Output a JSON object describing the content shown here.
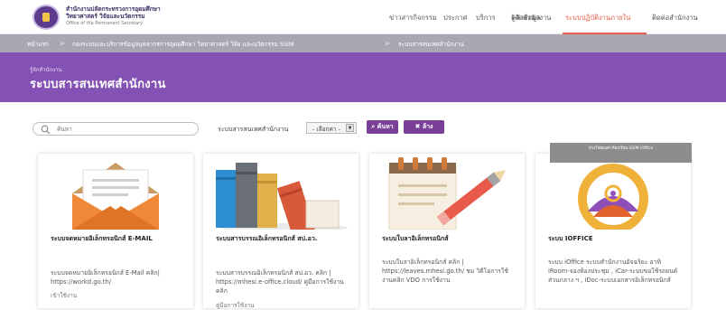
{
  "header": {
    "org_line1": "สำนักงานปลัดกระทรวงการอุดมศึกษา",
    "org_line2": "วิทยาศาสตร์ วิจัยและนวัตกรรม",
    "org_line3": "Office of the Permanent Secretary",
    "nav": [
      {
        "label": "ข่าวสารกิจกรรม"
      },
      {
        "label": "ประกาศ"
      },
      {
        "label": "บริการ"
      },
      {
        "label": "คลังข้อมูล"
      },
      {
        "label": "รู้จักสำนักงาน"
      },
      {
        "label": "ระบบปฏิบัติงานภายใน"
      },
      {
        "label": "ติดต่อสำนักงาน"
      }
    ],
    "active_color": "#e8604c"
  },
  "breadcrumb": {
    "items": [
      {
        "label": "หน้าแรก"
      },
      {
        "label": "กองระบบและบริการข้อมูลบุคลากรการอุดมศึกษา วิทยาศาสตร์ วิจัย และนวัตกรรม SSIM"
      },
      {
        "label": "ระบบสารสนเทศสำนักงาน"
      }
    ],
    "separator": ">"
  },
  "banner": {
    "subtitle": "รู้จักสำนักงาน",
    "title": "ระบบสารสนเทศสำนักงาน",
    "color": "#8452b4"
  },
  "search": {
    "placeholder": "ค้นหา",
    "filter_label": "ระบบสารสนเทศสำนักงาน",
    "select_value": "- เลือกค่า -",
    "search_button": "ค้นหา",
    "clear_button": "ล้าง"
  },
  "cards": [
    {
      "title": "ระบบจดหมายอิเล็กทรอนิกส์ E-MAIL",
      "desc": "ระบบจดหมายอิเล็กทรอนิกส์ E-Mail คลิก| https://workd.go.th/",
      "more": "เข้าใช้งาน",
      "icon": "envelope-icon"
    },
    {
      "title": "ระบบสารบรรณอิเล็กทรอนิกส์ สป.อว.",
      "desc": "ระบบสารบรรณอิเล็กทรอนิกส์ สป.อว. คลิก | https://mhesi.e-office.cloud/ คู่มือการใช้งานคลิก",
      "more": "คู่มือการใช้งาน",
      "icon": "books-icon"
    },
    {
      "title": "ระบบใบลาอิเล็กทรอนิกส์",
      "desc": "ระบบใบลาอิเล็กทรอนิกส์ คลิก | https://leaves.mhesi.go.th/ ชม วิดีโอการใช้งานคลิก VDO การใช้งาน",
      "more": "",
      "icon": "notepad-pencil-icon"
    },
    {
      "title": "ระบบ IOFFICE",
      "desc": "ระบบ iOffice ระบบสำนักงานอัจฉริยะ อาทิ iRoom-จองห้องประชุม , iCar-ระบบขอใช้รถยนต์ส่วนกลาง ฯ , iDoc-ระบบเอกสารอิเล็กทรอนิกส์",
      "more": "",
      "icon": "ioffice-logo-icon",
      "tag": "ห่วงโซ่คุณค่าห้องเรียน SSIM iOffice"
    }
  ]
}
